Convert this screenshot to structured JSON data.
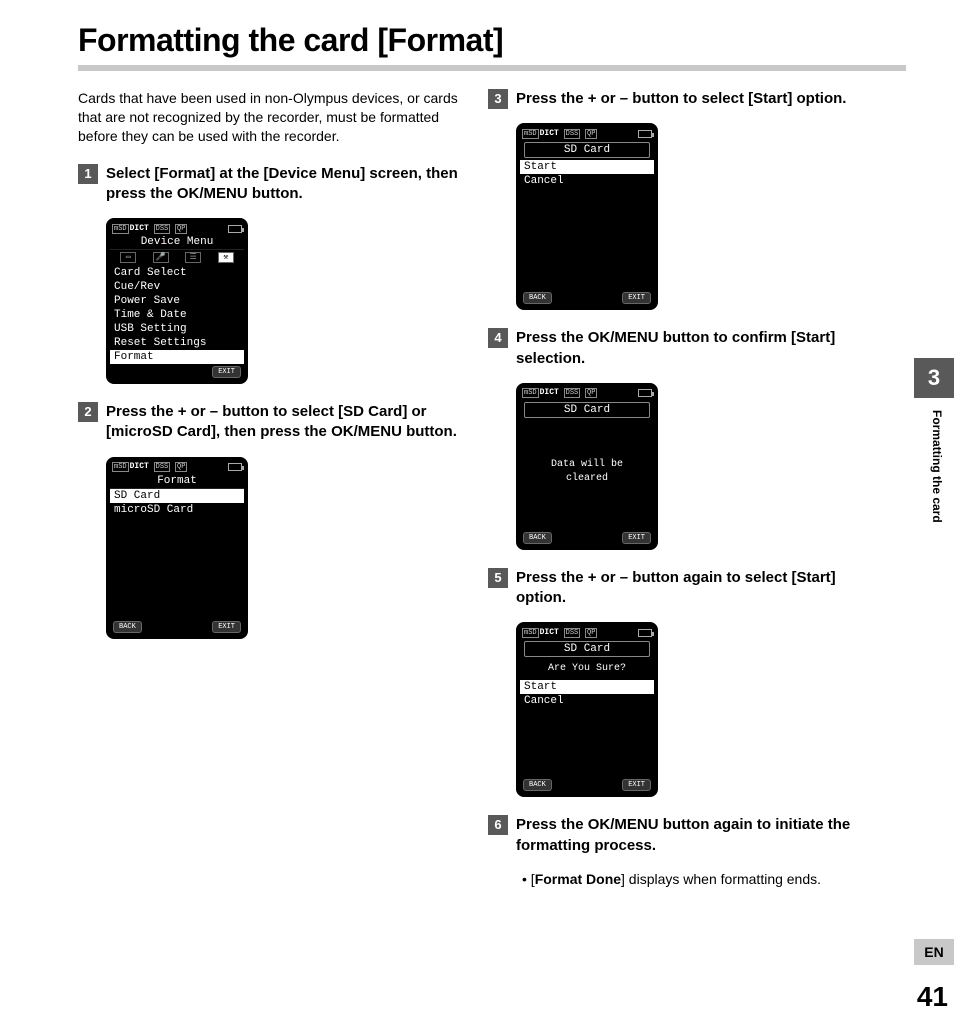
{
  "title": "Formatting the card [Format]",
  "intro": "Cards that have been used in non-Olympus devices, or cards that are not recognized by the recorder, must be formatted before they can be used with the recorder.",
  "chapter_number": "3",
  "side_label": "Formatting the card",
  "lang_tag": "EN",
  "page_number": "41",
  "steps": {
    "s1": {
      "num": "1",
      "line1_a": "Select [",
      "line1_b": "Format",
      "line1_c": "] at the [",
      "line1_d": "Device Menu",
      "line1_e": "] screen, then press the ",
      "line1_f": "OK/MENU",
      "line1_g": " button."
    },
    "s2": {
      "num": "2",
      "a": "Press the + or – button to select [",
      "b": "SD Card",
      "c": "] or [",
      "d": "microSD Card",
      "e": "], then press the ",
      "f": "OK/MENU",
      "g": " button."
    },
    "s3": {
      "num": "3",
      "a": "Press the + or – button to select [",
      "b": "Start",
      "c": "] option."
    },
    "s4": {
      "num": "4",
      "a": "Press the ",
      "b": "OK/MENU",
      "c": " button to confirm [",
      "d": "Start",
      "e": "] selection."
    },
    "s5": {
      "num": "5",
      "a": "Press the + or – button again to select [",
      "b": "Start",
      "c": "] option."
    },
    "s6": {
      "num": "6",
      "a": "Press the ",
      "b": "OK/MENU",
      "c": " button again to initiate the formatting process.",
      "bullet_a": "[",
      "bullet_b": "Format Done",
      "bullet_c": "] displays when formatting ends."
    }
  },
  "lcd": {
    "status_left": "mSD",
    "status_dict": "DICT",
    "status_dss": "DSS",
    "status_qp": "QP",
    "soft_back": "BACK",
    "soft_exit": "EXIT",
    "screen1": {
      "title": "Device Menu",
      "items": [
        "Card Select",
        "Cue/Rev",
        "Power Save",
        "Time & Date",
        "USB Setting",
        "Reset Settings",
        "Format"
      ],
      "selected_index": 6
    },
    "screen2": {
      "title": "Format",
      "items": [
        "SD Card",
        "microSD Card"
      ],
      "selected_index": 0
    },
    "screen3": {
      "title": "SD Card",
      "items": [
        "Start",
        "Cancel"
      ],
      "selected_index": 0
    },
    "screen4": {
      "title": "SD Card",
      "message_l1": "Data will be",
      "message_l2": "cleared"
    },
    "screen5": {
      "title": "SD Card",
      "question": "Are You Sure?",
      "items": [
        "Start",
        "Cancel"
      ],
      "selected_index": 0
    }
  }
}
